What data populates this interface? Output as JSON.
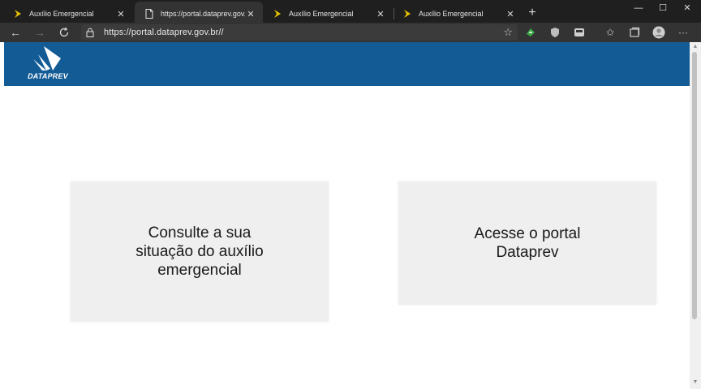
{
  "browser": {
    "tabs": [
      {
        "title": "Auxílio Emergencial",
        "active": false,
        "favicon": "auxilio-favicon"
      },
      {
        "title": "https://portal.dataprev.gov.br//",
        "active": true,
        "favicon": "page-icon"
      },
      {
        "title": "Auxílio Emergencial",
        "active": false,
        "favicon": "auxilio-favicon"
      },
      {
        "title": "Auxílio Emergencial",
        "active": false,
        "favicon": "auxilio-favicon"
      }
    ],
    "new_tab_label": "+",
    "address": "https://portal.dataprev.gov.br//",
    "colors": {
      "tabstrip": "#1f1f1f",
      "toolbar": "#333333",
      "accent_favicon": "#e8c200"
    }
  },
  "header": {
    "logo_text": "DATAPREV",
    "background": "#135b95"
  },
  "cards": [
    {
      "label": "Consulte a sua\nsituação do auxílio\nemergencial"
    },
    {
      "label": "Acesse o portal\nDataprev"
    }
  ]
}
